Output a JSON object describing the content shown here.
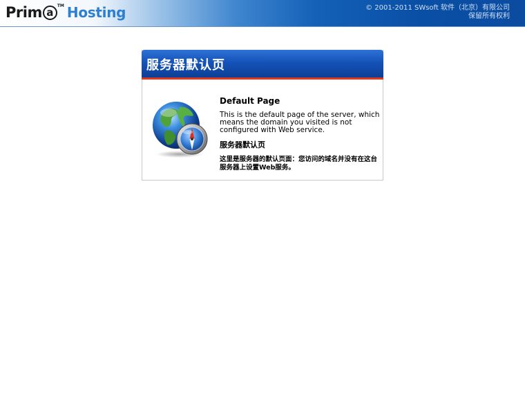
{
  "header": {
    "logo": {
      "prima": "Prim",
      "a_letter": "a",
      "tm": "TM",
      "hosting": "Hosting"
    },
    "copyright_line1": "© 2001-2011 SWsoft 软件（北京）有限公司",
    "copyright_line2": "保留所有权利"
  },
  "panel": {
    "title": "服务器默认页",
    "icon": "globe-compass-icon",
    "en_title": "Default Page",
    "en_text": "This is the default page of the server, which means the domain you visited is not configured with Web service.",
    "cn_title": "服务器默认页",
    "cn_text": "这里是服务器的默认页面：您访问的域名并没有在这台服务器上设置Web服务。"
  },
  "colors": {
    "header_blue": "#0b4ca0",
    "panel_blue": "#1553b9",
    "accent_red": "#e2371b",
    "hosting_blue": "#2e7fd0"
  }
}
